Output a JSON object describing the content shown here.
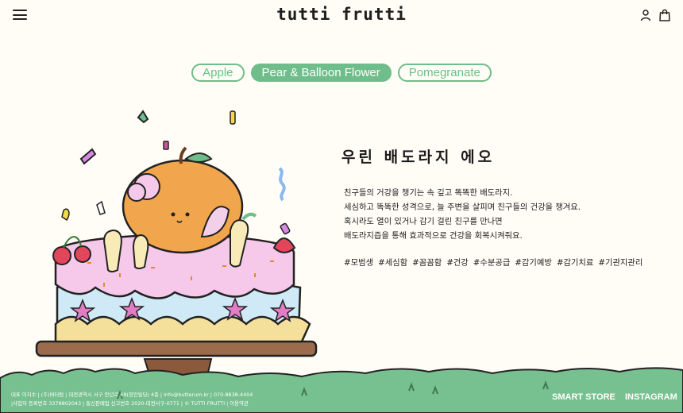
{
  "header": {
    "brand": "tutti frutti",
    "menu_icon": "hamburger-menu-icon",
    "user_icon": "user-icon",
    "cart_icon": "shopping-bag-icon"
  },
  "tabs": [
    {
      "label": "Apple",
      "active": false
    },
    {
      "label": "Pear & Balloon Flower",
      "active": true
    },
    {
      "label": "Pomegranate",
      "active": false
    }
  ],
  "main": {
    "headline": "우린 배도라지 에오",
    "description": [
      "친구들의 거강을 챙기는 속 깊고 똑똑한 배도라지.",
      "세심하고 똑똑한 성격으로, 늘 주변을 살피며 친구들의 건강을 챙겨요.",
      "혹시라도 열이 있거나 감기 걸린 친구를 만나면",
      "배도라지즙을 통해 효과적으로 건강을 회복시켜줘요."
    ],
    "tags": [
      "#모범생",
      "#세심함",
      "#꼼꼼함",
      "#건강",
      "#수분공급",
      "#감기예방",
      "#감기치료",
      "#기관지관리"
    ]
  },
  "footer": {
    "info_line1": "대표 이지수 | (주)버터럼 | 대전광역시 서구 만년로 68(정인빌딩) 4층 | info@butterum.kr | 070-8838-4404",
    "info_line2": "|사업자 등록번호 3378802043 | 통신판매업 신고번호 2020-대전서구-0771 | © TUTTI FRUTTI | 이용약관",
    "smart_store": "SMART STORE",
    "instagram": "INSTAGRAM"
  },
  "colors": {
    "accent_green": "#6fbd8a",
    "background": "#fffdf6",
    "cake_pink": "#f6c9ea",
    "cake_blue": "#cfeaf6",
    "pear_orange": "#f1a64e"
  }
}
